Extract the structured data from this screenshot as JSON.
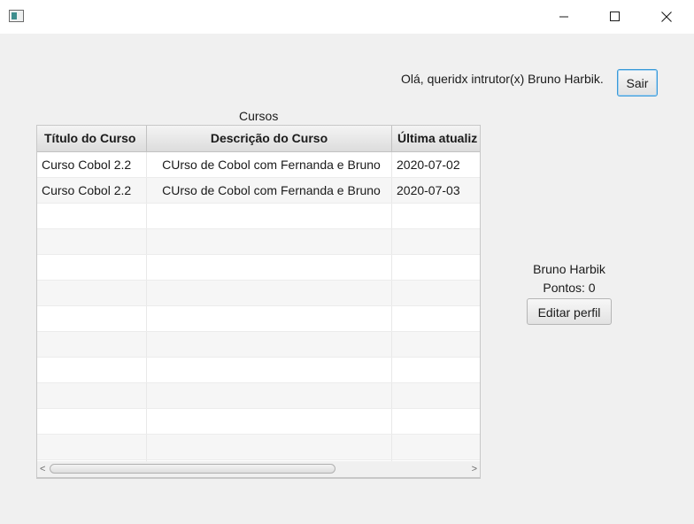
{
  "window": {
    "controls": {
      "minimize": "minimize",
      "maximize": "maximize",
      "close": "close"
    }
  },
  "header": {
    "greeting": "Olá, queridx intrutor(x) Bruno Harbik.",
    "logout_label": "Sair"
  },
  "courses": {
    "title": "Cursos",
    "columns": [
      "Título do Curso",
      "Descrição do Curso",
      "Última atualiz"
    ],
    "rows": [
      {
        "title": "Curso Cobol 2.2",
        "description": "CUrso de Cobol com Fernanda e Bruno",
        "updated": "2020-07-02"
      },
      {
        "title": "Curso Cobol 2.2",
        "description": "CUrso de Cobol com Fernanda e Bruno",
        "updated": "2020-07-03"
      }
    ],
    "scroll": {
      "left_arrow": "<",
      "right_arrow": ">"
    }
  },
  "profile": {
    "name": "Bruno Harbik",
    "points": "Pontos: 0",
    "edit_label": "Editar perfil"
  }
}
